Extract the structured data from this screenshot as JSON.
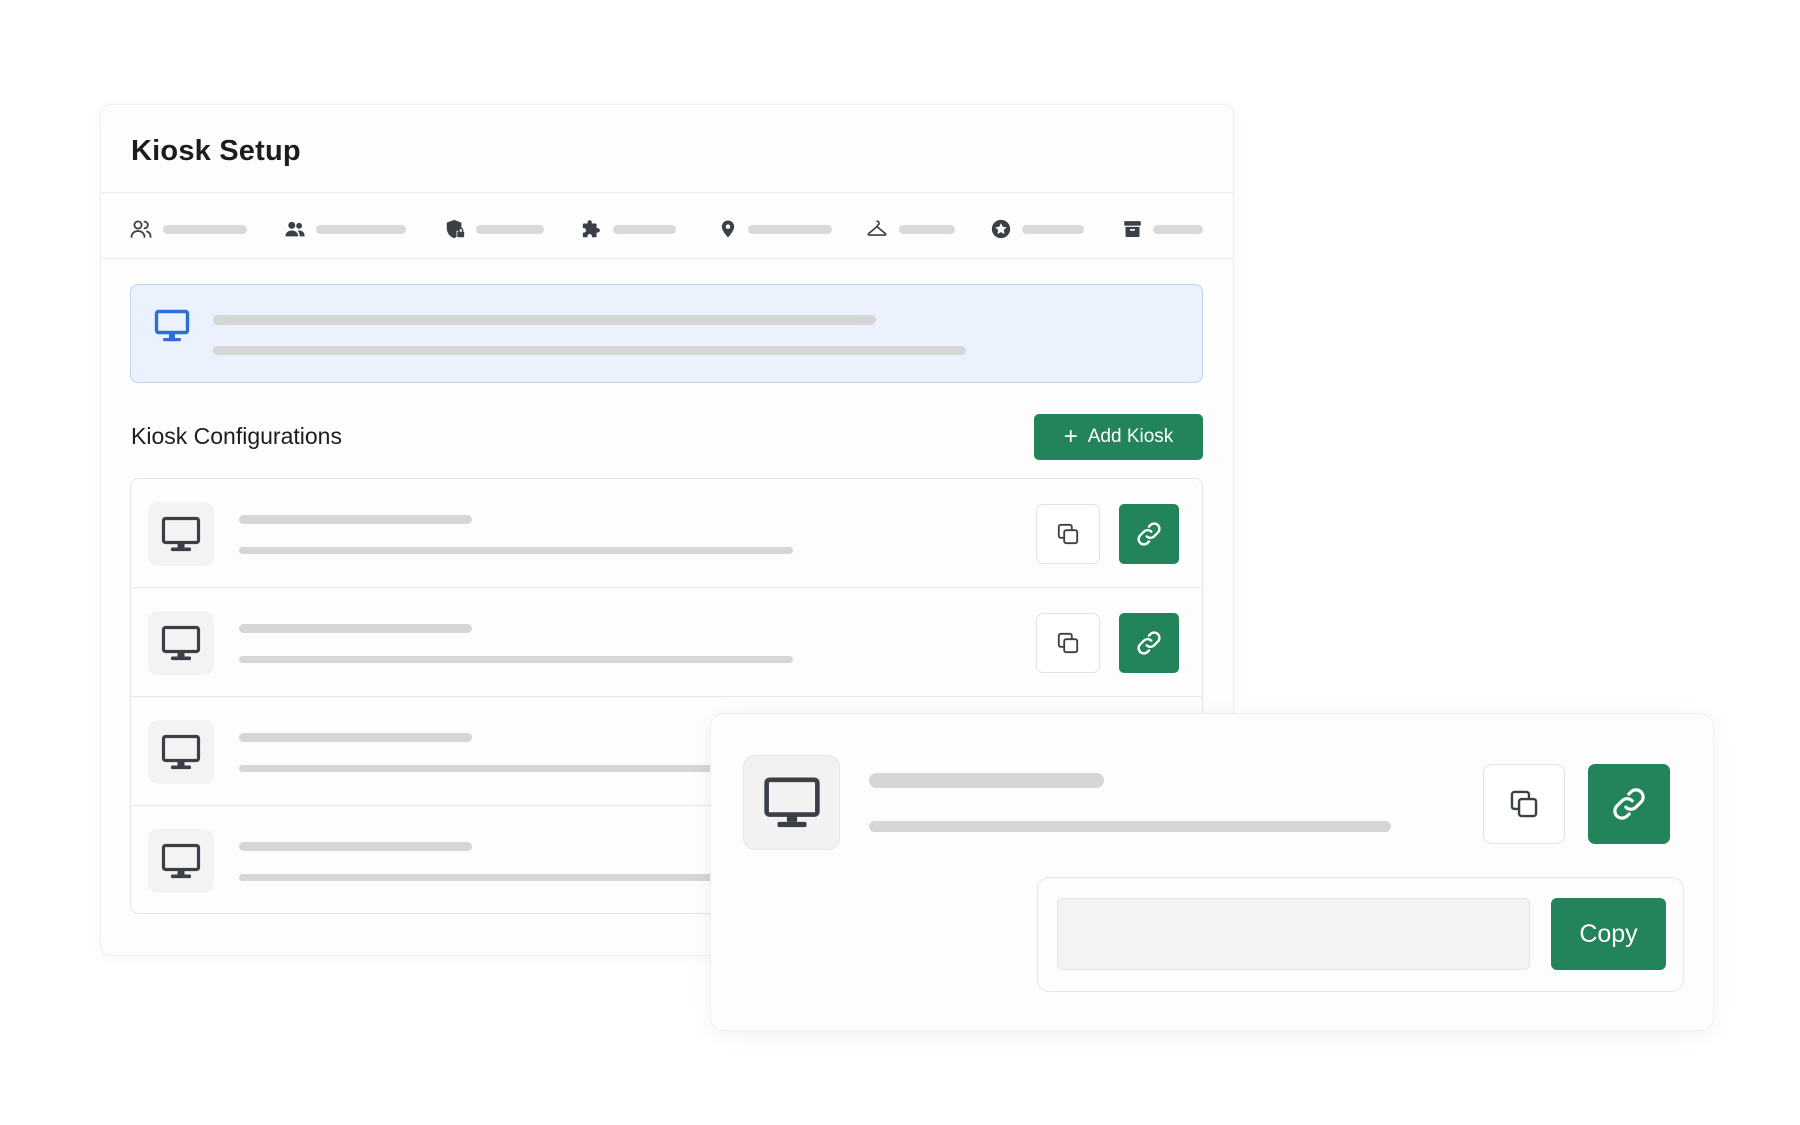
{
  "header": {
    "title": "Kiosk Setup"
  },
  "tabs": [
    {
      "icon": "users-outline-icon"
    },
    {
      "icon": "users-group-icon"
    },
    {
      "icon": "shield-lock-icon"
    },
    {
      "icon": "puzzle-icon"
    },
    {
      "icon": "map-pin-icon"
    },
    {
      "icon": "hanger-icon"
    },
    {
      "icon": "star-circle-icon"
    },
    {
      "icon": "archive-box-icon"
    }
  ],
  "banner": {
    "icon": "monitor-icon",
    "accent": "#2f6ed8"
  },
  "section": {
    "title": "Kiosk Configurations",
    "add_button_label": "Add Kiosk"
  },
  "kiosk_list": {
    "item_icon": "monitor-icon",
    "copy_icon": "copy-icon",
    "link_icon": "link-icon",
    "row_count": 4
  },
  "detail_card": {
    "copy_button_label": "Copy",
    "url_input_value": ""
  },
  "colors": {
    "primary": "#23845b",
    "banner_bg": "#ebf2fd",
    "banner_border": "#bfd2f1",
    "skeleton": "#d6d6d6",
    "icon_dark": "#3b3f46"
  }
}
